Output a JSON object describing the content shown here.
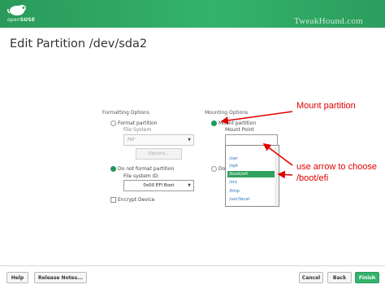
{
  "header": {
    "brand_prefix": "open",
    "brand_suffix": "SUSE",
    "watermark": "TweakHound.com"
  },
  "page": {
    "title": "Edit Partition /dev/sda2"
  },
  "formatting": {
    "title": "Formatting Options",
    "format_label": "Format partition",
    "file_system_label": "File System",
    "file_system_value": "FAT",
    "options_button": "Options...",
    "no_format_label": "Do not format partition",
    "fs_id_label": "File system ID:",
    "fs_id_value": "0x00 EFI Boot",
    "encrypt_label": "Encrypt Device"
  },
  "mounting": {
    "title": "Mounting Options",
    "mount_label": "Mount partition",
    "mount_point_label": "Mount Point",
    "mount_point_value": "",
    "do_not_mount_prefix": "Do",
    "options": [
      "/var",
      "/opt",
      "/boot/efi",
      "/srv",
      "/tmp",
      "/usr/local"
    ],
    "selected_option": "/boot/efi"
  },
  "annotations": {
    "mount_partition": "Mount partition",
    "choose_line1": "use arrow to choose",
    "choose_line2": "/boot/efi"
  },
  "footer": {
    "help": "Help",
    "release_notes": "Release Notes...",
    "cancel": "Cancel",
    "back": "Back",
    "finish": "Finish"
  },
  "colors": {
    "accent": "#34b36c",
    "annotation": "#e00000"
  }
}
